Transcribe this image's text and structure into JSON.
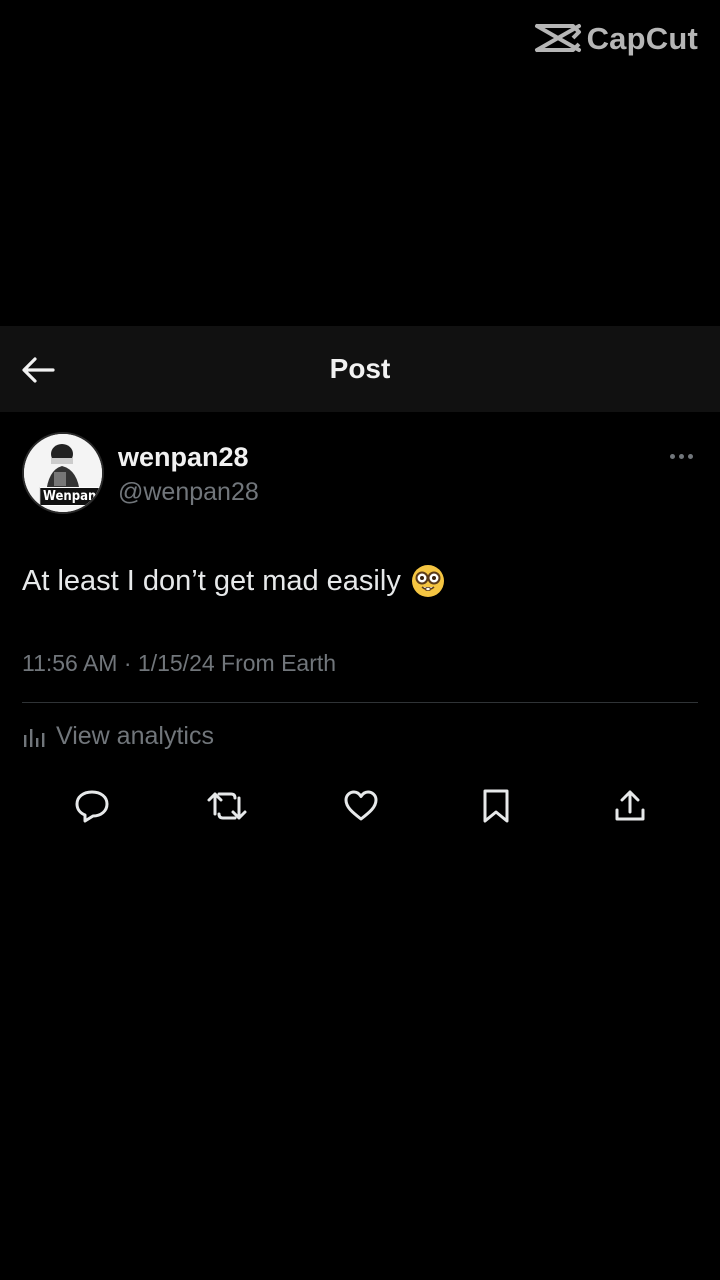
{
  "watermark": {
    "brand": "CapCut",
    "icon": "capcut-logo-icon"
  },
  "header": {
    "title": "Post",
    "back_icon": "arrow-left-icon"
  },
  "post": {
    "author": {
      "display_name": "wenpan28",
      "handle": "@wenpan28",
      "avatar_badge": "Wenpan"
    },
    "text": "At least I don’t get mad easily",
    "emoji_icon": "nerd-face-emoji-icon",
    "meta": "11:56 AM · 1/15/24 From Earth",
    "analytics_label": "View analytics"
  },
  "actions": [
    {
      "name": "reply",
      "icon": "reply-icon"
    },
    {
      "name": "repost",
      "icon": "repost-icon"
    },
    {
      "name": "like",
      "icon": "heart-icon"
    },
    {
      "name": "bookmark",
      "icon": "bookmark-icon"
    },
    {
      "name": "share",
      "icon": "share-icon"
    }
  ],
  "colors": {
    "background": "#000000",
    "header_bg": "#111111",
    "primary_text": "#e7e9ea",
    "secondary_text": "#71767b",
    "divider": "#2f3336"
  }
}
